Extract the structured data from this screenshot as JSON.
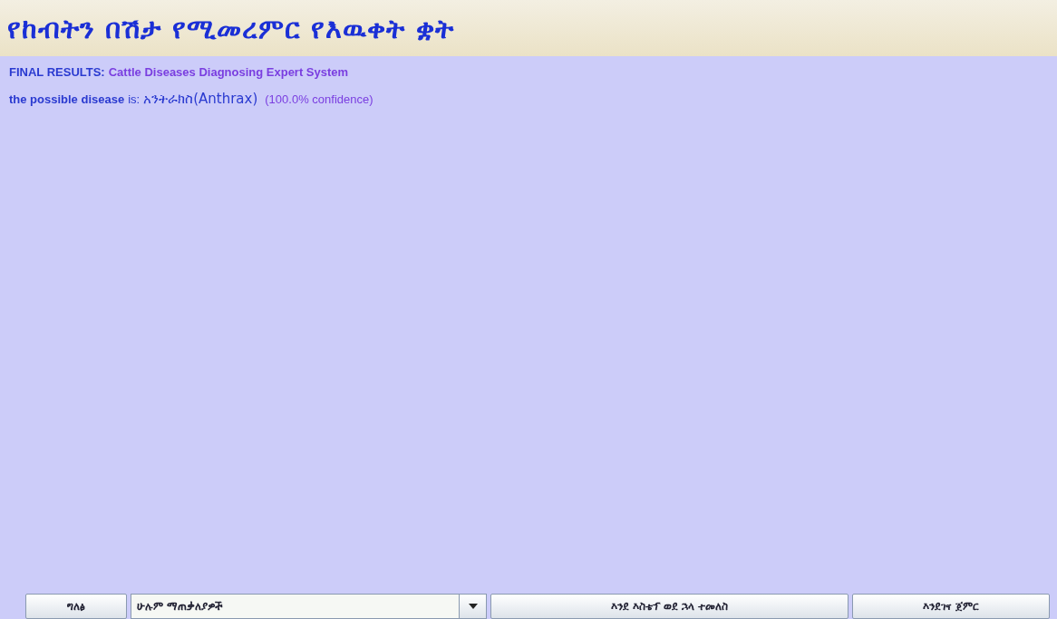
{
  "window": {
    "title": "የከብትን በሽታ የሚመረምር የእዉቀት ቋት"
  },
  "results": {
    "label": "FINAL RESULTS:",
    "system": "Cattle Diseases Diagnosing Expert System",
    "disease_label": "the possible disease",
    "is": "is:",
    "disease": "አንትራክስ(Anthrax)",
    "confidence": "(100.0% confidence)"
  },
  "controls": [
    {
      "kind": "button",
      "label": "ግለፅ"
    },
    {
      "kind": "dropdown",
      "value": "ሁሉም ማጠቃለያዎች"
    },
    {
      "kind": "button",
      "label": "እንደ እስቴፕ ወደ ኋላ ተመለስ"
    },
    {
      "kind": "button",
      "label": "እንደገና ጀምር"
    }
  ]
}
